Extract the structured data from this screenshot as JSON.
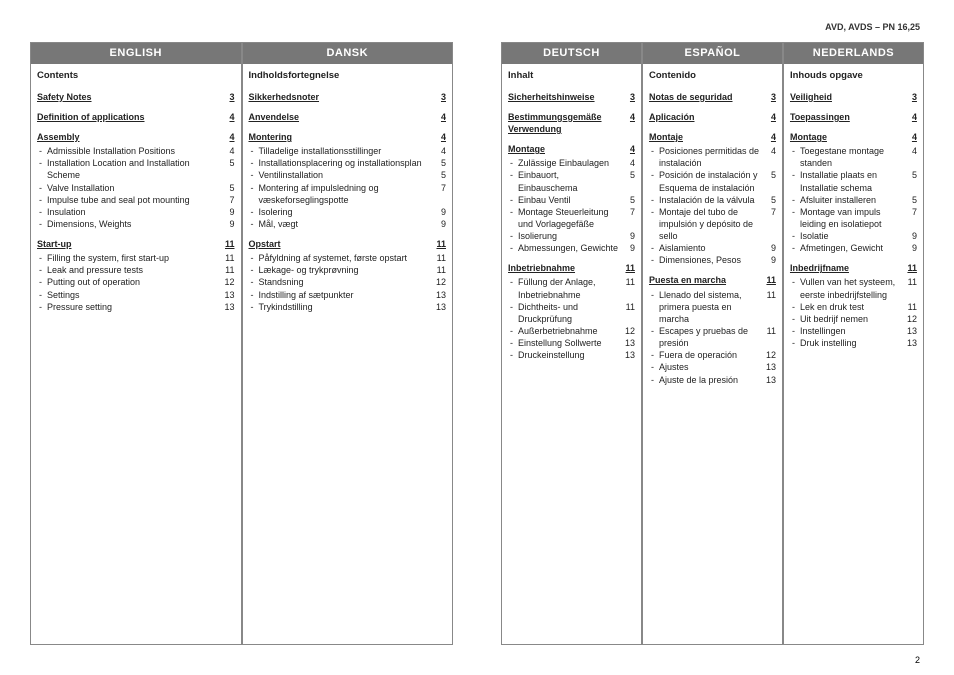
{
  "header": "AVD, AVDS – PN 16,25",
  "pageNumber": "2",
  "columns": [
    {
      "title": "ENGLISH",
      "contentsLabel": "Contents",
      "sections": [
        {
          "heading": "Safety Notes",
          "page": "3",
          "items": []
        },
        {
          "heading": "Definition of applications",
          "page": "4",
          "items": []
        },
        {
          "heading": "Assembly",
          "page": "4",
          "items": [
            {
              "text": "Admissible Installation Positions",
              "page": "4"
            },
            {
              "text": "Installation Location and Installation Scheme",
              "page": "5"
            },
            {
              "text": "Valve Installation",
              "page": "5"
            },
            {
              "text": "Impulse tube and seal pot mounting",
              "page": "7"
            },
            {
              "text": "Insulation",
              "page": "9"
            },
            {
              "text": "Dimensions, Weights",
              "page": "9"
            }
          ]
        },
        {
          "heading": "Start-up",
          "page": "11",
          "items": [
            {
              "text": "Filling the system, first start-up",
              "page": "11"
            },
            {
              "text": "Leak and pressure tests",
              "page": "11"
            },
            {
              "text": "Putting out of operation",
              "page": "12"
            },
            {
              "text": "Settings",
              "page": "13"
            },
            {
              "text": "Pressure setting",
              "page": "13"
            }
          ]
        }
      ]
    },
    {
      "title": "DANSK",
      "contentsLabel": "Indholdsfortegnelse",
      "sections": [
        {
          "heading": "Sikkerhedsnoter",
          "page": "3",
          "items": []
        },
        {
          "heading": "Anvendelse",
          "page": "4",
          "items": []
        },
        {
          "heading": "Montering",
          "page": "4",
          "items": [
            {
              "text": "Tilladelige installationsstillinger",
              "page": "4"
            },
            {
              "text": "Installationsplacering og installationsplan",
              "page": "5"
            },
            {
              "text": "Ventilinstallation",
              "page": "5"
            },
            {
              "text": "Montering af impulsledning og væskeforseglingspotte",
              "page": "7"
            },
            {
              "text": "Isolering",
              "page": "9"
            },
            {
              "text": "Mål, vægt",
              "page": "9"
            }
          ]
        },
        {
          "heading": "Opstart",
          "page": "11",
          "items": [
            {
              "text": "Påfyldning af systemet, første opstart",
              "page": "11"
            },
            {
              "text": "Lækage- og trykprøvning",
              "page": "11"
            },
            {
              "text": "Standsning",
              "page": "12"
            },
            {
              "text": "Indstilling af sætpunkter",
              "page": "13"
            },
            {
              "text": "Trykindstilling",
              "page": "13"
            }
          ]
        }
      ]
    },
    {
      "title": "DEUTSCH",
      "contentsLabel": "Inhalt",
      "sections": [
        {
          "heading": "Sicherheitshinweise",
          "page": "3",
          "items": []
        },
        {
          "heading": "Bestimmungsgemäße Verwendung",
          "page": "4",
          "items": []
        },
        {
          "heading": "Montage",
          "page": "4",
          "items": [
            {
              "text": "Zulässige Einbaulagen",
              "page": "4"
            },
            {
              "text": "Einbauort, Einbauschema",
              "page": "5"
            },
            {
              "text": "Einbau Ventil",
              "page": "5"
            },
            {
              "text": "Montage Steuerleitung und Vorlagegefäße",
              "page": "7"
            },
            {
              "text": "Isolierung",
              "page": "9"
            },
            {
              "text": "Abmessungen, Gewichte",
              "page": "9"
            }
          ]
        },
        {
          "heading": "Inbetriebnahme",
          "page": "11",
          "items": [
            {
              "text": "Füllung der Anlage, Inbetriebnahme",
              "page": "11"
            },
            {
              "text": "Dichtheits- und Druckprüfung",
              "page": "11"
            },
            {
              "text": "Außerbetriebnahme",
              "page": "12"
            },
            {
              "text": "Einstellung Sollwerte",
              "page": "13"
            },
            {
              "text": "Druckeinstellung",
              "page": "13"
            }
          ]
        }
      ]
    },
    {
      "title": "ESPAÑOL",
      "contentsLabel": "Contenido",
      "sections": [
        {
          "heading": "Notas de seguridad",
          "page": "3",
          "items": []
        },
        {
          "heading": "Aplicación",
          "page": "4",
          "items": []
        },
        {
          "heading": "Montaje",
          "page": "4",
          "items": [
            {
              "text": "Posiciones permitidas de instalación",
              "page": "4"
            },
            {
              "text": "Posición de instalación y Esquema de instalación",
              "page": "5"
            },
            {
              "text": "Instalación de la válvula",
              "page": "5"
            },
            {
              "text": "Montaje del tubo de impulsión y depósito de sello",
              "page": "7"
            },
            {
              "text": "Aislamiento",
              "page": "9"
            },
            {
              "text": "Dimensiones, Pesos",
              "page": "9"
            }
          ]
        },
        {
          "heading": "Puesta en marcha",
          "page": "11",
          "items": [
            {
              "text": "Llenado del sistema, primera puesta en marcha",
              "page": "11"
            },
            {
              "text": "Escapes y pruebas de presión",
              "page": "11"
            },
            {
              "text": "Fuera de operación",
              "page": "12"
            },
            {
              "text": "Ajustes",
              "page": "13"
            },
            {
              "text": "Ajuste de la presión",
              "page": "13"
            }
          ]
        }
      ]
    },
    {
      "title": "NEDERLANDS",
      "contentsLabel": "Inhouds opgave",
      "sections": [
        {
          "heading": "Veiligheid",
          "page": "3",
          "items": []
        },
        {
          "heading": "Toepassingen",
          "page": "4",
          "items": []
        },
        {
          "heading": "Montage",
          "page": "4",
          "items": [
            {
              "text": "Toegestane montage standen",
              "page": "4"
            },
            {
              "text": "Installatie plaats en Installatie schema",
              "page": "5"
            },
            {
              "text": "Afsluiter installeren",
              "page": "5"
            },
            {
              "text": "Montage van impuls leiding en isolatiepot",
              "page": "7"
            },
            {
              "text": "Isolatie",
              "page": "9"
            },
            {
              "text": "Afmetingen, Gewicht",
              "page": "9"
            }
          ]
        },
        {
          "heading": "Inbedrijfname",
          "page": "11",
          "items": [
            {
              "text": "Vullen van het systeem, eerste inbedrijfstelling",
              "page": "11"
            },
            {
              "text": "Lek en druk test",
              "page": "11"
            },
            {
              "text": "Uit bedrijf nemen",
              "page": "12"
            },
            {
              "text": "Instellingen",
              "page": "13"
            },
            {
              "text": "Druk instelling",
              "page": "13"
            }
          ]
        }
      ]
    }
  ]
}
